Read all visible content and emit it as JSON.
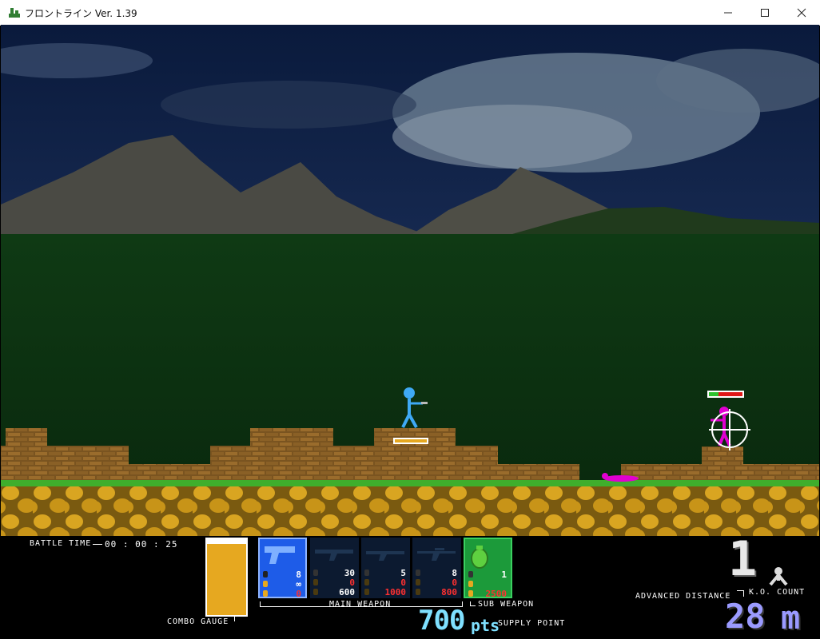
{
  "window": {
    "title": "フロントライン Ver. 1.39",
    "minimize": "—",
    "maximize": "☐",
    "close": "✕"
  },
  "hud": {
    "battle_time_label": "BATTLE TIME",
    "battle_time_value": "00 : 00 : 25",
    "combo_gauge_label": "COMBO GAUGE",
    "main_weapon_label": "MAIN WEAPON",
    "sub_weapon_label": "SUB WEAPON",
    "supply_points": "700",
    "supply_points_unit": "pts",
    "supply_point_label": "SUPPLY POINT",
    "ko_count": "1",
    "ko_count_label": "K.O. COUNT",
    "advanced_distance_label": "ADVANCED DISTANCE",
    "advanced_distance_value": "28",
    "advanced_distance_unit": "m",
    "main_weapons": [
      {
        "icon": "pistol-icon",
        "ammo": "8",
        "reserve": "∞",
        "cost": "0",
        "selected": true
      },
      {
        "icon": "rifle-icon",
        "ammo": "30",
        "reserve": "0",
        "cost": "600",
        "selected": false
      },
      {
        "icon": "shotgun-icon",
        "ammo": "5",
        "reserve": "0",
        "cost": "1000",
        "selected": false
      },
      {
        "icon": "sniper-icon",
        "ammo": "8",
        "reserve": "0",
        "cost": "800",
        "selected": false
      }
    ],
    "sub_weapon": {
      "icon": "grenade-icon",
      "ammo": "1",
      "cost": "2500"
    }
  },
  "colors": {
    "player": "#3fa9f5",
    "enemy": "#e000d0",
    "gauge": "#e6a820",
    "pistol_slot": "#1e5ce8",
    "sub_slot": "#1c9a3a",
    "distance": "#8080ff",
    "supply": "#7fe0ff"
  }
}
